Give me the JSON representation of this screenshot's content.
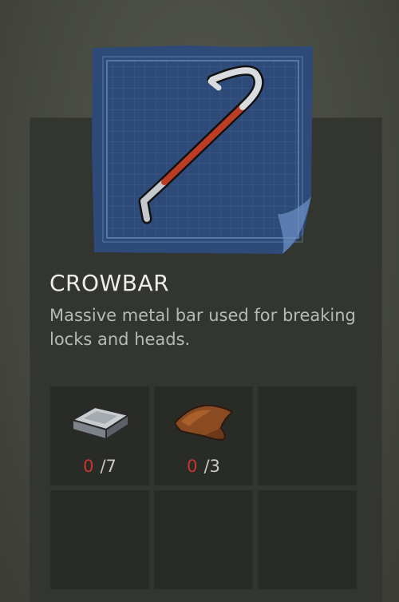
{
  "item": {
    "name": "CROWBAR",
    "description": "Massive metal bar used for breaking locks and heads.",
    "icon": "crowbar-blueprint-icon"
  },
  "colors": {
    "blueprint": "#2e4a76",
    "accent_red": "#c8362a",
    "slot_bg": "#292b27"
  },
  "materials": [
    {
      "icon": "metal-ingot-icon",
      "have": "0",
      "need": "/7"
    },
    {
      "icon": "leather-icon",
      "have": "0",
      "need": "/3"
    }
  ]
}
